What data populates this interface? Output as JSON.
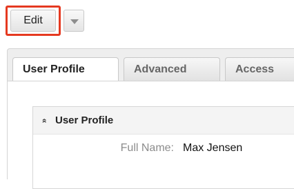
{
  "toolbar": {
    "edit_label": "Edit",
    "highlight_color": "#e53920"
  },
  "tabs": [
    {
      "label": "User Profile",
      "active": true
    },
    {
      "label": "Advanced",
      "active": false
    },
    {
      "label": "Access",
      "active": false
    }
  ],
  "section": {
    "title": "User Profile",
    "collapse_icon": "double-chevron-up-icon",
    "fields": [
      {
        "label": "Full Name:",
        "value": "Max Jensen"
      }
    ]
  }
}
